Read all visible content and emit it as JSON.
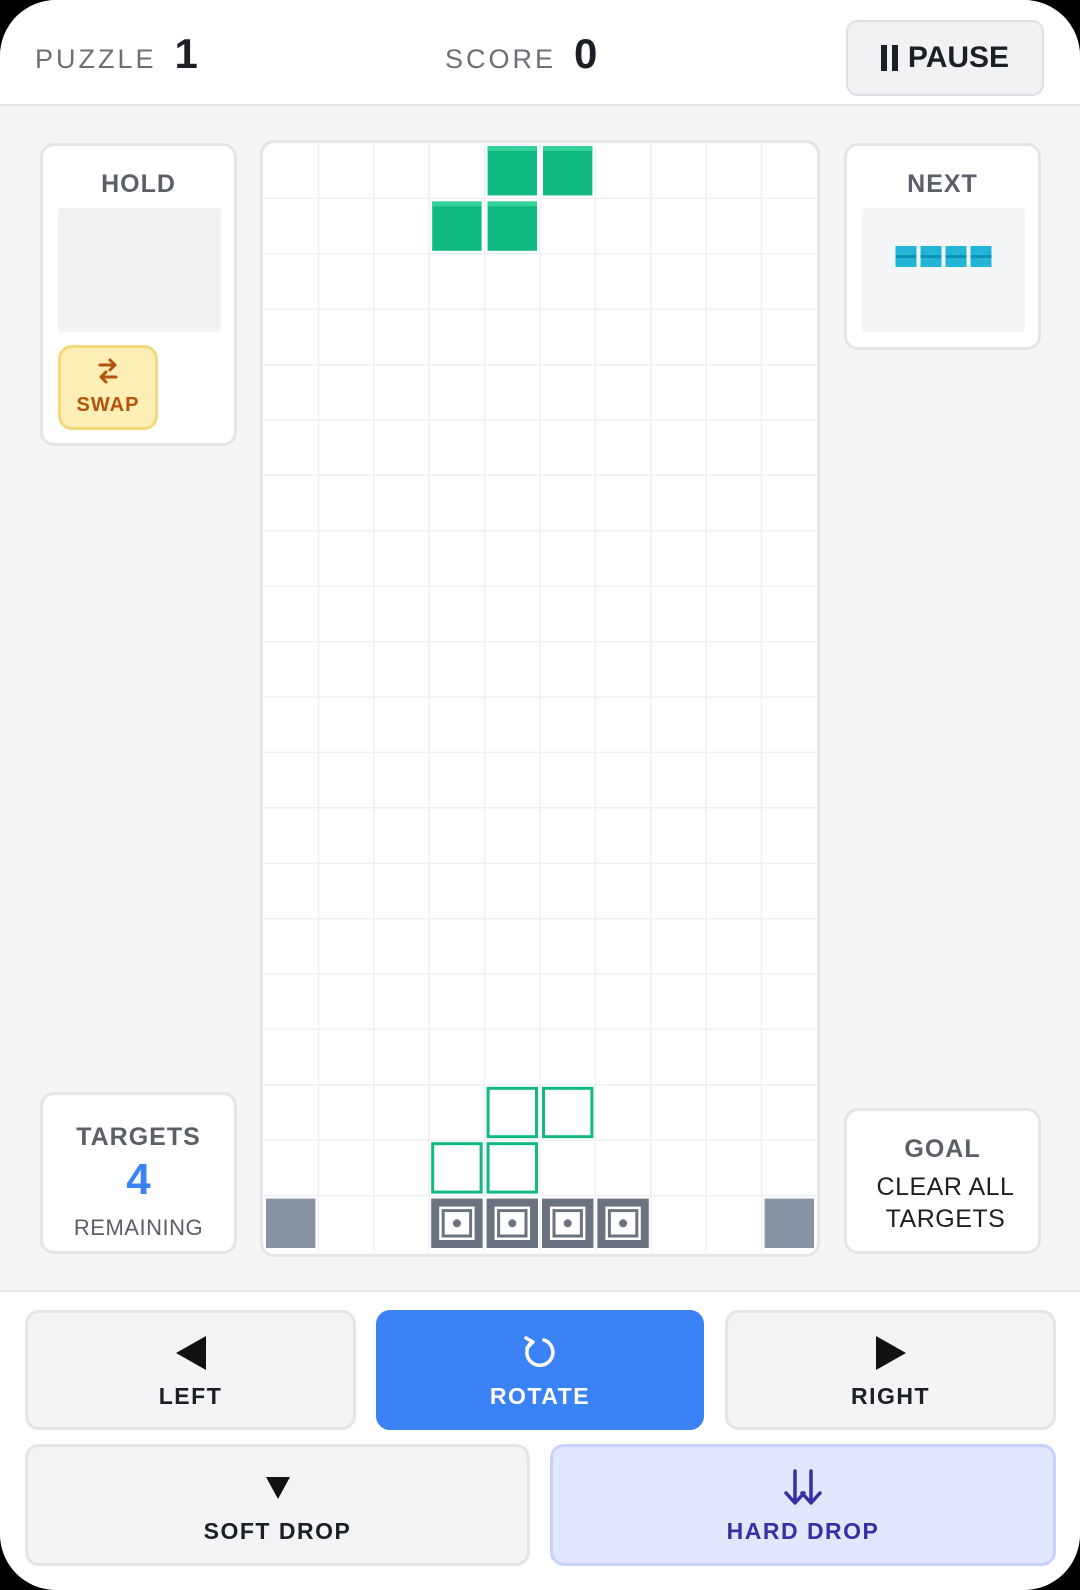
{
  "header": {
    "puzzle_label": "PUZZLE",
    "puzzle_value": "1",
    "score_label": "SCORE",
    "score_value": "0",
    "pause_label": "PAUSE",
    "pause_icon": "pause-icon"
  },
  "hold": {
    "title": "HOLD",
    "swap_label": "SWAP",
    "swap_icon": "swap-arrows-icon"
  },
  "next": {
    "title": "NEXT",
    "piece": "I",
    "piece_color": "#22b5d8"
  },
  "targets": {
    "title": "TARGETS",
    "count": "4",
    "sub": "REMAINING"
  },
  "goal": {
    "title": "GOAL",
    "line1": "CLEAR ALL",
    "line2": "TARGETS"
  },
  "board": {
    "columns": 10,
    "rows": 20,
    "active_piece": {
      "type": "S",
      "color": "#10b981",
      "cells": [
        [
          4,
          0
        ],
        [
          5,
          0
        ],
        [
          3,
          1
        ],
        [
          4,
          1
        ]
      ]
    },
    "ghost_piece": {
      "type": "S",
      "color": "#10b981",
      "cells": [
        [
          4,
          17
        ],
        [
          5,
          17
        ],
        [
          3,
          18
        ],
        [
          4,
          18
        ]
      ]
    },
    "blocks": [
      [
        0,
        19
      ],
      [
        9,
        19
      ]
    ],
    "block_color": "#8793a3",
    "target_cells": [
      [
        3,
        19
      ],
      [
        4,
        19
      ],
      [
        5,
        19
      ],
      [
        6,
        19
      ]
    ],
    "target_color": "#6b7280"
  },
  "controls": {
    "left_label": "LEFT",
    "rotate_label": "ROTATE",
    "right_label": "RIGHT",
    "soft_drop_label": "SOFT DROP",
    "hard_drop_label": "HARD DROP"
  }
}
